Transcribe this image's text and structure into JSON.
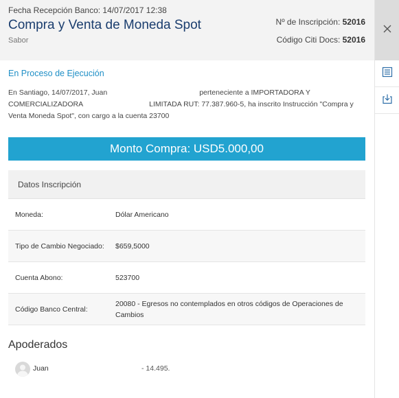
{
  "header": {
    "date_label": "Fecha Recepción Banco: 14/07/2017 12:38",
    "title": "Compra y Venta de Moneda Spot",
    "subtitle": "Sabor",
    "inscripcion_label": "Nº de Inscripción: ",
    "inscripcion_value": "52016",
    "citi_label": "Código Citi Docs: ",
    "citi_value": "52016"
  },
  "status": "En Proceso de Ejecución",
  "paragraph": {
    "part1": "En Santiago, 14/07/2017, Juan",
    "part2": "perteneciente a IMPORTADORA Y",
    "part3": "COMERCIALIZADORA",
    "part4": "LIMITADA RUT: 77.387.960-5, ha inscrito Instrucción \"Compra y",
    "part5": "Venta Moneda Spot\", con cargo a la cuenta 23700"
  },
  "banner": "Monto Compra: USD5.000,00",
  "datos": {
    "title": "Datos Inscripción",
    "rows": [
      {
        "label": "Moneda:",
        "value": "Dólar Americano"
      },
      {
        "label": "Tipo de Cambio Negociado:",
        "value": "$659,5000"
      },
      {
        "label": "Cuenta Abono:",
        "value": "523700"
      },
      {
        "label": "Código Banco Central:",
        "value": "20080 - Egresos no contemplados en otros códigos de Operaciones de Cambios"
      }
    ]
  },
  "apoderados": {
    "title": "Apoderados",
    "items": [
      {
        "name": "Juan",
        "rut": "- 14.495."
      }
    ]
  },
  "sidebar": {
    "icons": [
      "close-icon",
      "list-icon",
      "download-icon"
    ]
  },
  "colors": {
    "accent": "#22a3d0",
    "title": "#1a3d6e",
    "status": "#1f8fc6"
  }
}
